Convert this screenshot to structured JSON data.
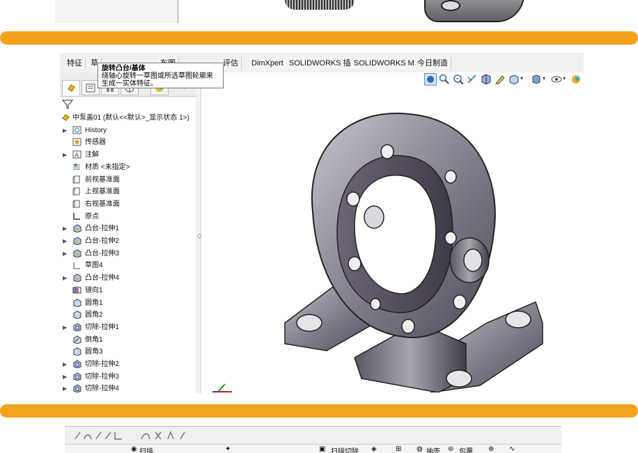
{
  "top_strip": {},
  "command_manager": {
    "tabs": [
      "特征",
      "草",
      "布图",
      "评估",
      "DimXpert",
      "SOLIDWORKS 插件",
      "SOLIDWORKS MBD",
      "今日制造"
    ]
  },
  "tooltip": {
    "title": "旋转凸台/基体",
    "line1": "绕轴心旋转一草图或所选草图轮廓来",
    "line2": "生成一实体特征。"
  },
  "feature_tree": {
    "root": "中泵盖01 (默认<<默认>_显示状态 1>)",
    "items": [
      {
        "label": "History",
        "arrow": true,
        "icon": "history-icon"
      },
      {
        "label": "传感器",
        "arrow": false,
        "icon": "sensor-icon"
      },
      {
        "label": "注解",
        "arrow": true,
        "icon": "annotation-icon"
      },
      {
        "label": "材质 <未指定>",
        "arrow": false,
        "icon": "material-icon"
      },
      {
        "label": "前视基准面",
        "arrow": false,
        "icon": "plane-icon"
      },
      {
        "label": "上视基准面",
        "arrow": false,
        "icon": "plane-icon"
      },
      {
        "label": "右视基准面",
        "arrow": false,
        "icon": "plane-icon"
      },
      {
        "label": "原点",
        "arrow": false,
        "icon": "origin-icon"
      },
      {
        "label": "凸台-拉伸1",
        "arrow": true,
        "icon": "extrude-icon"
      },
      {
        "label": "凸台-拉伸2",
        "arrow": true,
        "icon": "extrude-icon"
      },
      {
        "label": "凸台-拉伸3",
        "arrow": true,
        "icon": "extrude-icon"
      },
      {
        "label": "草图4",
        "arrow": false,
        "icon": "sketch-icon"
      },
      {
        "label": "凸台-拉伸4",
        "arrow": true,
        "icon": "extrude-icon"
      },
      {
        "label": "镜向1",
        "arrow": false,
        "icon": "mirror-icon"
      },
      {
        "label": "圆角1",
        "arrow": false,
        "icon": "fillet-icon"
      },
      {
        "label": "圆角2",
        "arrow": false,
        "icon": "fillet-icon"
      },
      {
        "label": "切除-拉伸1",
        "arrow": true,
        "icon": "cut-icon"
      },
      {
        "label": "倒角1",
        "arrow": false,
        "icon": "chamfer-icon"
      },
      {
        "label": "圆角3",
        "arrow": false,
        "icon": "fillet-icon"
      },
      {
        "label": "切除-拉伸2",
        "arrow": true,
        "icon": "cut-icon"
      },
      {
        "label": "切除-拉伸3",
        "arrow": true,
        "icon": "cut-icon"
      },
      {
        "label": "切除-拉伸4",
        "arrow": true,
        "icon": "cut-icon"
      }
    ]
  },
  "bottom_strip": {
    "sweep": "扫描",
    "sweep_cut": "扫描切除",
    "shell": "抽壳",
    "wrap": "包覆"
  },
  "colors": {
    "separator": "#f4a21b",
    "part_body": "#6f6c78",
    "part_highlight": "#c9c6cf"
  }
}
